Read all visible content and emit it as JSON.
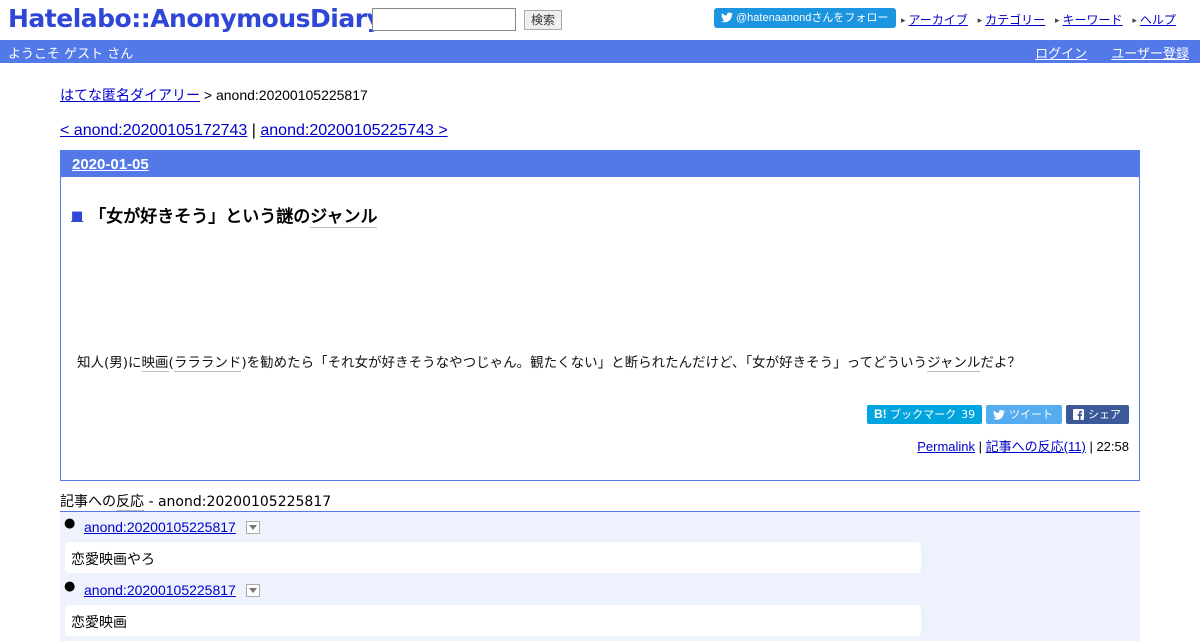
{
  "header": {
    "logo": "Hatelabo::AnonymousDiary",
    "search_button": "検索",
    "search_value": "",
    "follow_label": "@hatenaanondさんをフォロー",
    "nav": [
      "アーカイブ",
      "カテゴリー",
      "キーワード",
      "ヘルプ"
    ]
  },
  "userbar": {
    "welcome": "ようこそ ゲスト さん",
    "login": "ログイン",
    "register": "ユーザー登録"
  },
  "breadcrumb": {
    "home": "はてな匿名ダイアリー",
    "separator": ">",
    "current": "anond:20200105225817"
  },
  "pager": {
    "prev": "< anond:20200105172743",
    "separator": "|",
    "next": "anond:20200105225743 >"
  },
  "entry": {
    "date": "2020-01-05",
    "square": "■",
    "title_pre": "「女が好きそう」という謎の",
    "title_kw": "ジャンル",
    "body_1": "知人(男)に",
    "body_kw1": "映画",
    "body_2": "(",
    "body_kw2": "ラ",
    "body_kw3": "ラ",
    "body_kw4": "ランド",
    "body_3": ")を勧めたら「それ女が好きそうなやつじゃん。観たくない」と断られたんだけど、「女が好きそう」ってどういう",
    "body_kw5": "ジャンル",
    "body_4": "だよ？",
    "share": {
      "hatena_label": "ブックマーク",
      "hatena_count": "39",
      "tweet_label": "ツイート",
      "fb_label": "シェア"
    },
    "footer": {
      "permalink": "Permalink",
      "sep1": "|",
      "reactions": "記事への反応(11)",
      "sep2": "|",
      "time": "22:58"
    }
  },
  "references": {
    "title_pre": "記事への",
    "title_kw": "反応",
    "title_post": " - anond:20200105225817",
    "items": [
      {
        "link": "anond:20200105225817",
        "text": "恋愛映画やろ"
      },
      {
        "link": "anond:20200105225817",
        "text": "恋愛映画"
      }
    ]
  },
  "colors": {
    "brand_blue": "#5279e7",
    "logo_blue": "#2f46d6",
    "twitter_blue": "#1b95e0",
    "hatena_blue": "#00a4de",
    "facebook_blue": "#3b5998"
  }
}
